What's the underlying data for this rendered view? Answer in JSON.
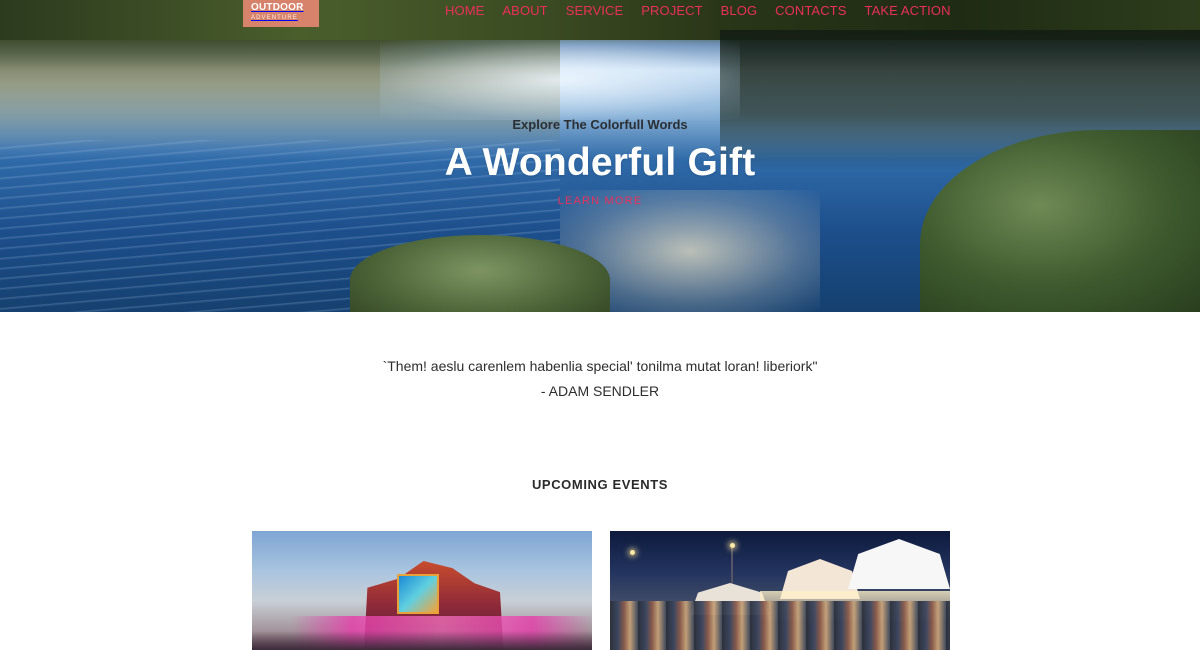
{
  "brand": {
    "name_line1": "OUTDOOR",
    "name_line2": "ADVENTURE"
  },
  "nav": {
    "items": [
      {
        "label": "HOME"
      },
      {
        "label": "ABOUT"
      },
      {
        "label": "SERVICE"
      },
      {
        "label": "PROJECT"
      },
      {
        "label": "BLOG"
      },
      {
        "label": "CONTACTS"
      },
      {
        "label": "TAKE ACTION"
      }
    ]
  },
  "hero": {
    "subtitle": "Explore The Colorfull Words",
    "title": "A Wonderful Gift",
    "cta_label": "LEARN MORE"
  },
  "quote": {
    "text": "`Them! aeslu carenlem habenlia special' tonilma mutat loran! liberiork\"",
    "author": "- ADAM SENDLER"
  },
  "events": {
    "heading": "UPCOMING EVENTS"
  },
  "colors": {
    "accent": "#ec2f5a",
    "logo_bg": "#d7826a",
    "text_dark": "#2d2d2d"
  }
}
